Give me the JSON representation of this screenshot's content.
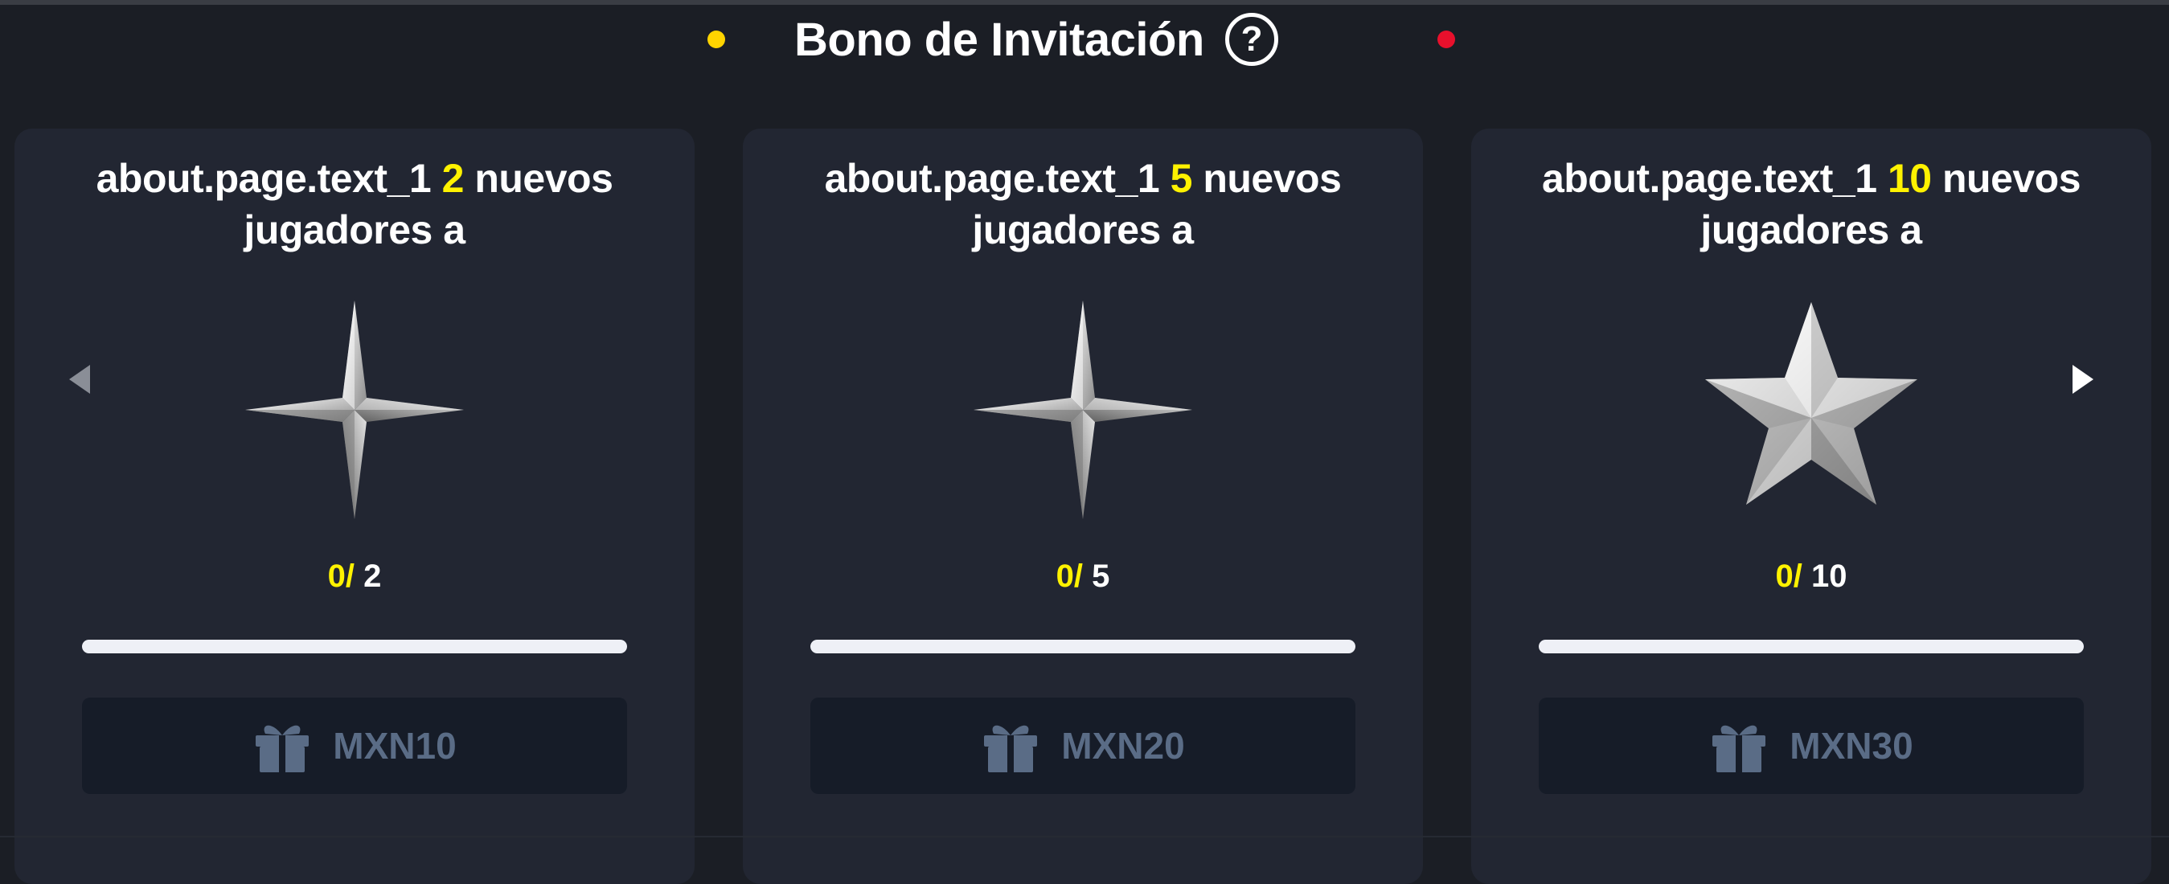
{
  "header": {
    "title": "Bono de Invitación",
    "help_symbol": "?",
    "dot_left_color": "#ffd400",
    "dot_right_color": "#e8102c"
  },
  "cards": [
    {
      "title_prefix": "about.page.text_1",
      "count": "2",
      "title_suffix": "nuevos",
      "title_line2": "jugadores a",
      "star_icon": "four-point-star-icon",
      "progress_current": "0/",
      "progress_total": "2",
      "progress_fraction": 0,
      "reward_label": "MXN10"
    },
    {
      "title_prefix": "about.page.text_1",
      "count": "5",
      "title_suffix": "nuevos",
      "title_line2": "jugadores a",
      "star_icon": "four-point-star-icon",
      "progress_current": "0/",
      "progress_total": "5",
      "progress_fraction": 0,
      "reward_label": "MXN20"
    },
    {
      "title_prefix": "about.page.text_1",
      "count": "10",
      "title_suffix": "nuevos",
      "title_line2": "jugadores a",
      "star_icon": "five-point-star-icon",
      "progress_current": "0/",
      "progress_total": "10",
      "progress_fraction": 0,
      "reward_label": "MXN30"
    }
  ],
  "colors": {
    "highlight": "#fff200",
    "card_bg": "#222632",
    "page_bg": "#1b1e25",
    "claim_text": "#5a6c86"
  }
}
